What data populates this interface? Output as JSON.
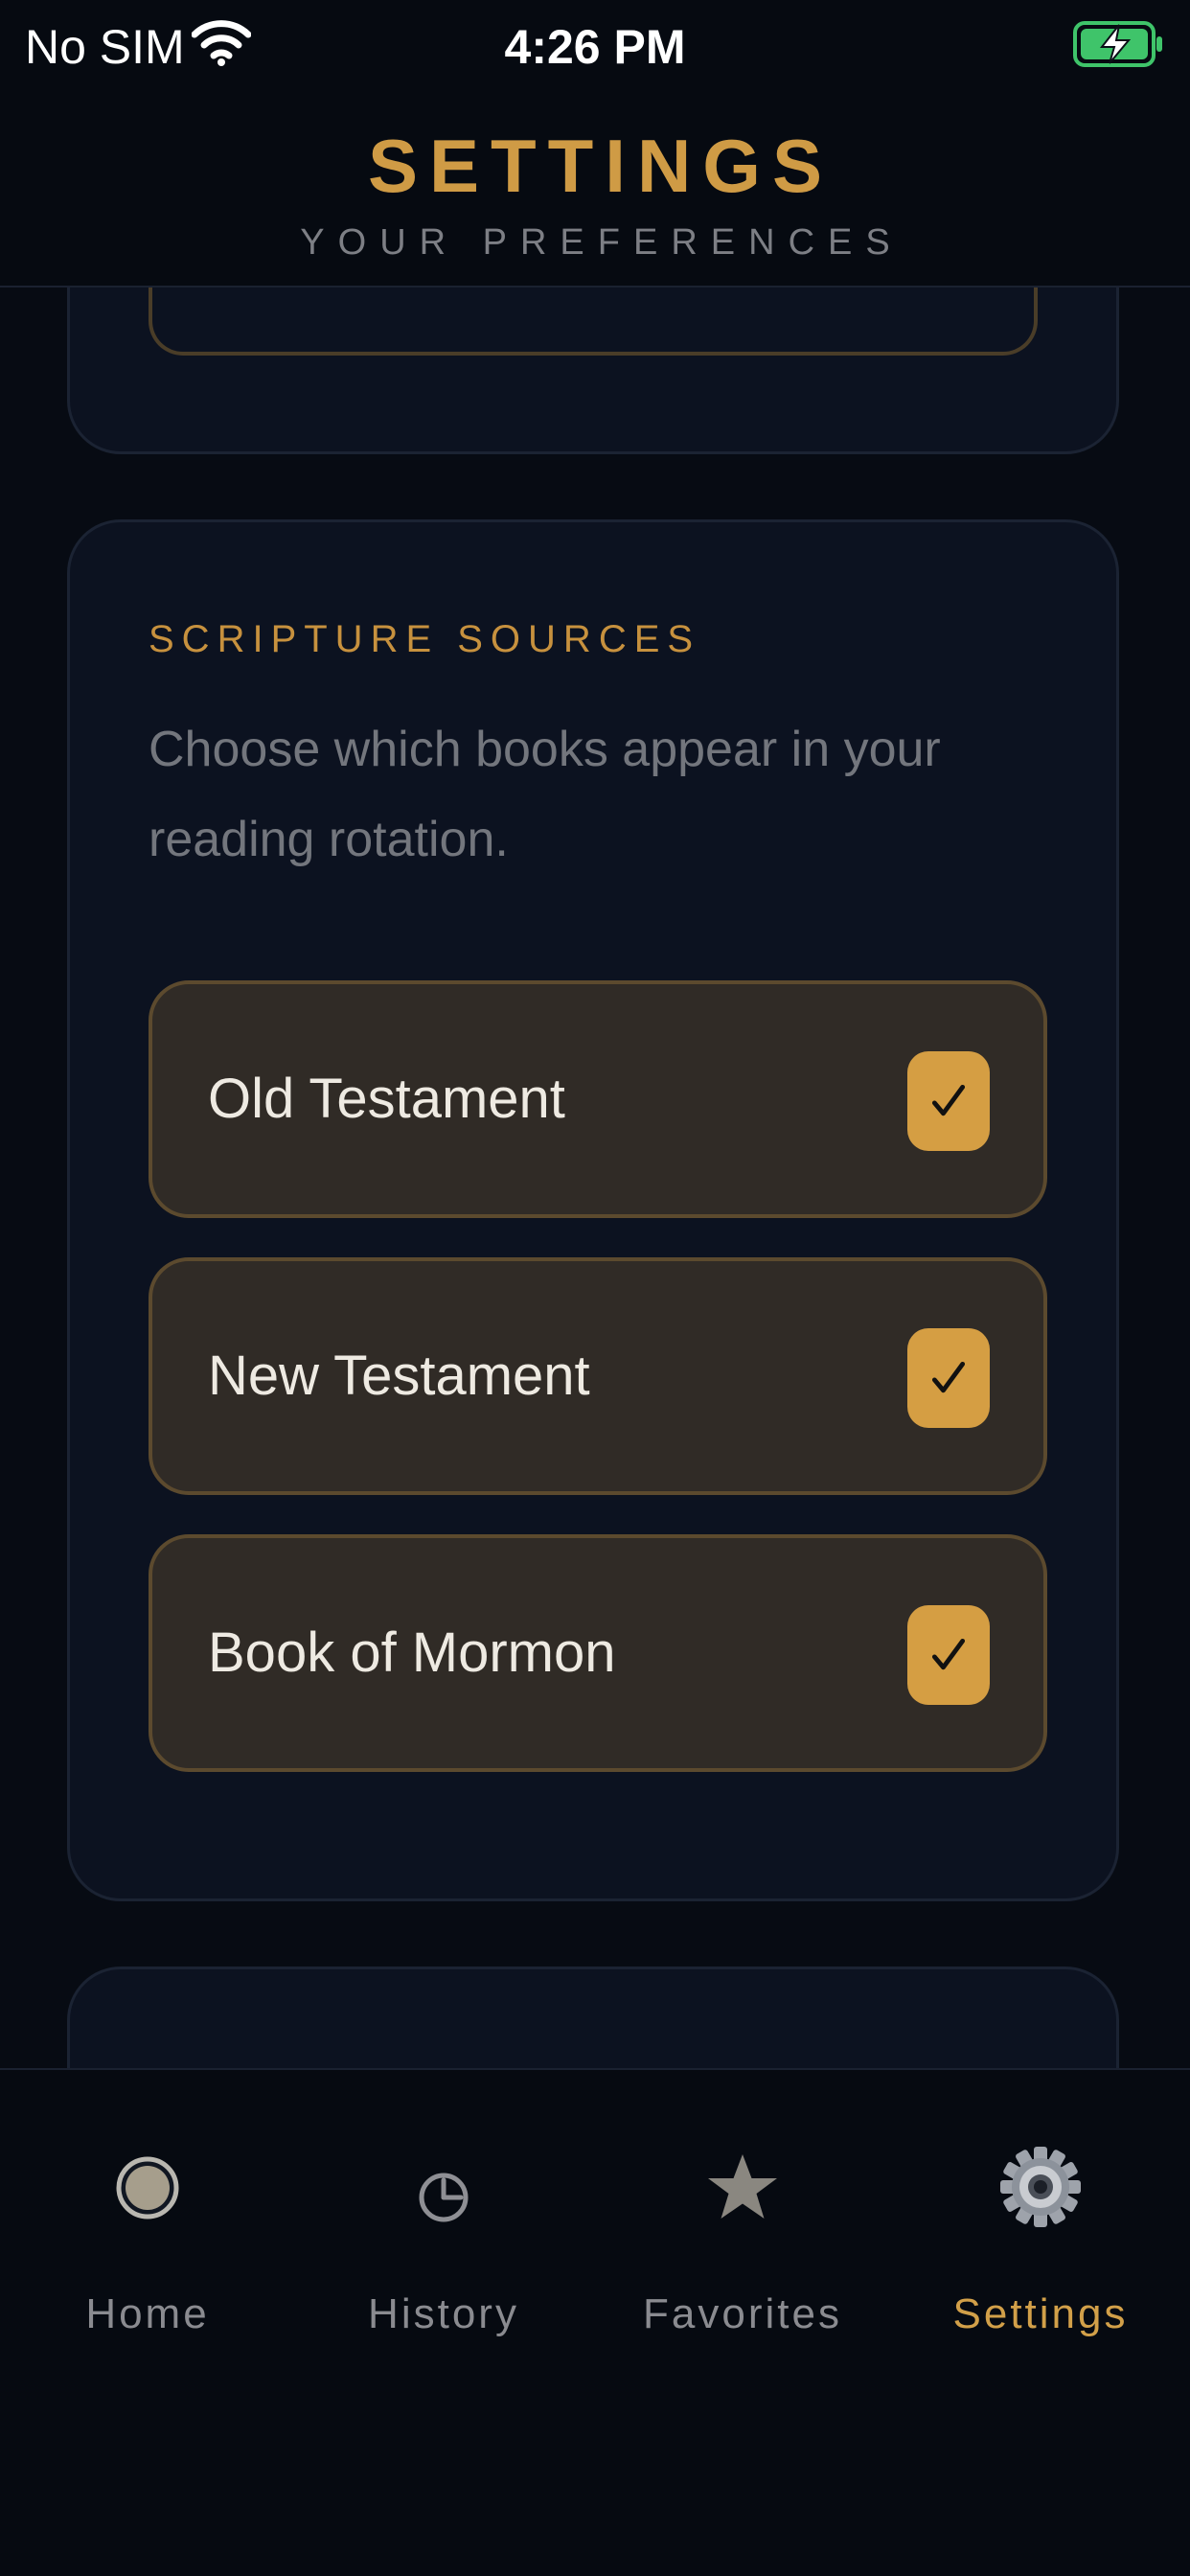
{
  "status_bar": {
    "carrier": "No SIM",
    "time": "4:26 PM",
    "wifi_icon": "wifi-icon",
    "battery_icon": "battery-charging-icon"
  },
  "header": {
    "title": "SETTINGS",
    "subtitle": "YOUR PREFERENCES"
  },
  "scripture_sources": {
    "title": "SCRIPTURE SOURCES",
    "description": "Choose which books appear in your reading rotation.",
    "items": [
      {
        "label": "Old Testament",
        "checked": true
      },
      {
        "label": "New Testament",
        "checked": true
      },
      {
        "label": "Book of Mormon",
        "checked": true
      }
    ]
  },
  "tab_bar": {
    "tabs": [
      {
        "label": "Home",
        "icon": "home-icon",
        "active": false
      },
      {
        "label": "History",
        "icon": "clock-icon",
        "active": false
      },
      {
        "label": "Favorites",
        "icon": "star-icon",
        "active": false
      },
      {
        "label": "Settings",
        "icon": "gear-icon",
        "active": true
      }
    ]
  },
  "colors": {
    "accent": "#cf9b45",
    "background": "#070b13",
    "card": "#0c1220",
    "row": "#302b26"
  }
}
